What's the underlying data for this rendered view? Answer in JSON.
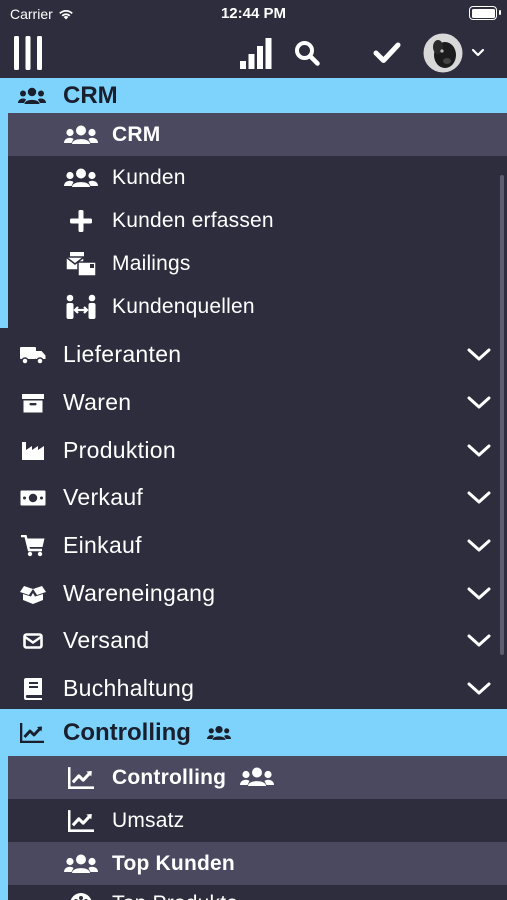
{
  "status_bar": {
    "carrier": "Carrier",
    "time": "12:44 PM"
  },
  "toolbar": {
    "menu_icon": "columns-icon",
    "stats_icon": "signal-bars-icon",
    "search_icon": "search-icon",
    "check_icon": "check-icon",
    "avatar_icon": "avatar",
    "dropdown_icon": "chevron-down-icon"
  },
  "menu": {
    "crm_group": {
      "label": "CRM",
      "icon": "users-icon",
      "items": [
        {
          "label": "CRM",
          "icon": "users-icon",
          "active": true
        },
        {
          "label": "Kunden",
          "icon": "users-icon"
        },
        {
          "label": "Kunden erfassen",
          "icon": "plus-icon"
        },
        {
          "label": "Mailings",
          "icon": "mail-bulk-icon"
        },
        {
          "label": "Kundenquellen",
          "icon": "people-arrows-icon"
        }
      ]
    },
    "sections": [
      {
        "label": "Lieferanten",
        "icon": "truck-icon"
      },
      {
        "label": "Waren",
        "icon": "archive-icon"
      },
      {
        "label": "Produktion",
        "icon": "industry-icon"
      },
      {
        "label": "Verkauf",
        "icon": "money-bill-icon"
      },
      {
        "label": "Einkauf",
        "icon": "cart-icon"
      },
      {
        "label": "Wareneingang",
        "icon": "box-open-icon"
      },
      {
        "label": "Versand",
        "icon": "envelope-icon"
      },
      {
        "label": "Buchhaltung",
        "icon": "book-icon"
      }
    ],
    "controlling_group": {
      "label": "Controlling",
      "icon": "chart-line-icon",
      "badge_icon": "users-icon",
      "items": [
        {
          "label": "Controlling",
          "icon": "chart-line-icon",
          "active": true,
          "badge_icon": "users-icon"
        },
        {
          "label": "Umsatz",
          "icon": "chart-line-icon"
        },
        {
          "label": "Top Kunden",
          "icon": "users-icon",
          "bold": true
        },
        {
          "label": "Top Produkte",
          "icon": "palette-icon"
        }
      ]
    }
  },
  "colors": {
    "background": "#2e2d3d",
    "accent": "#7dd3fb",
    "active_row": "#4a4960",
    "text": "#ffffff"
  }
}
